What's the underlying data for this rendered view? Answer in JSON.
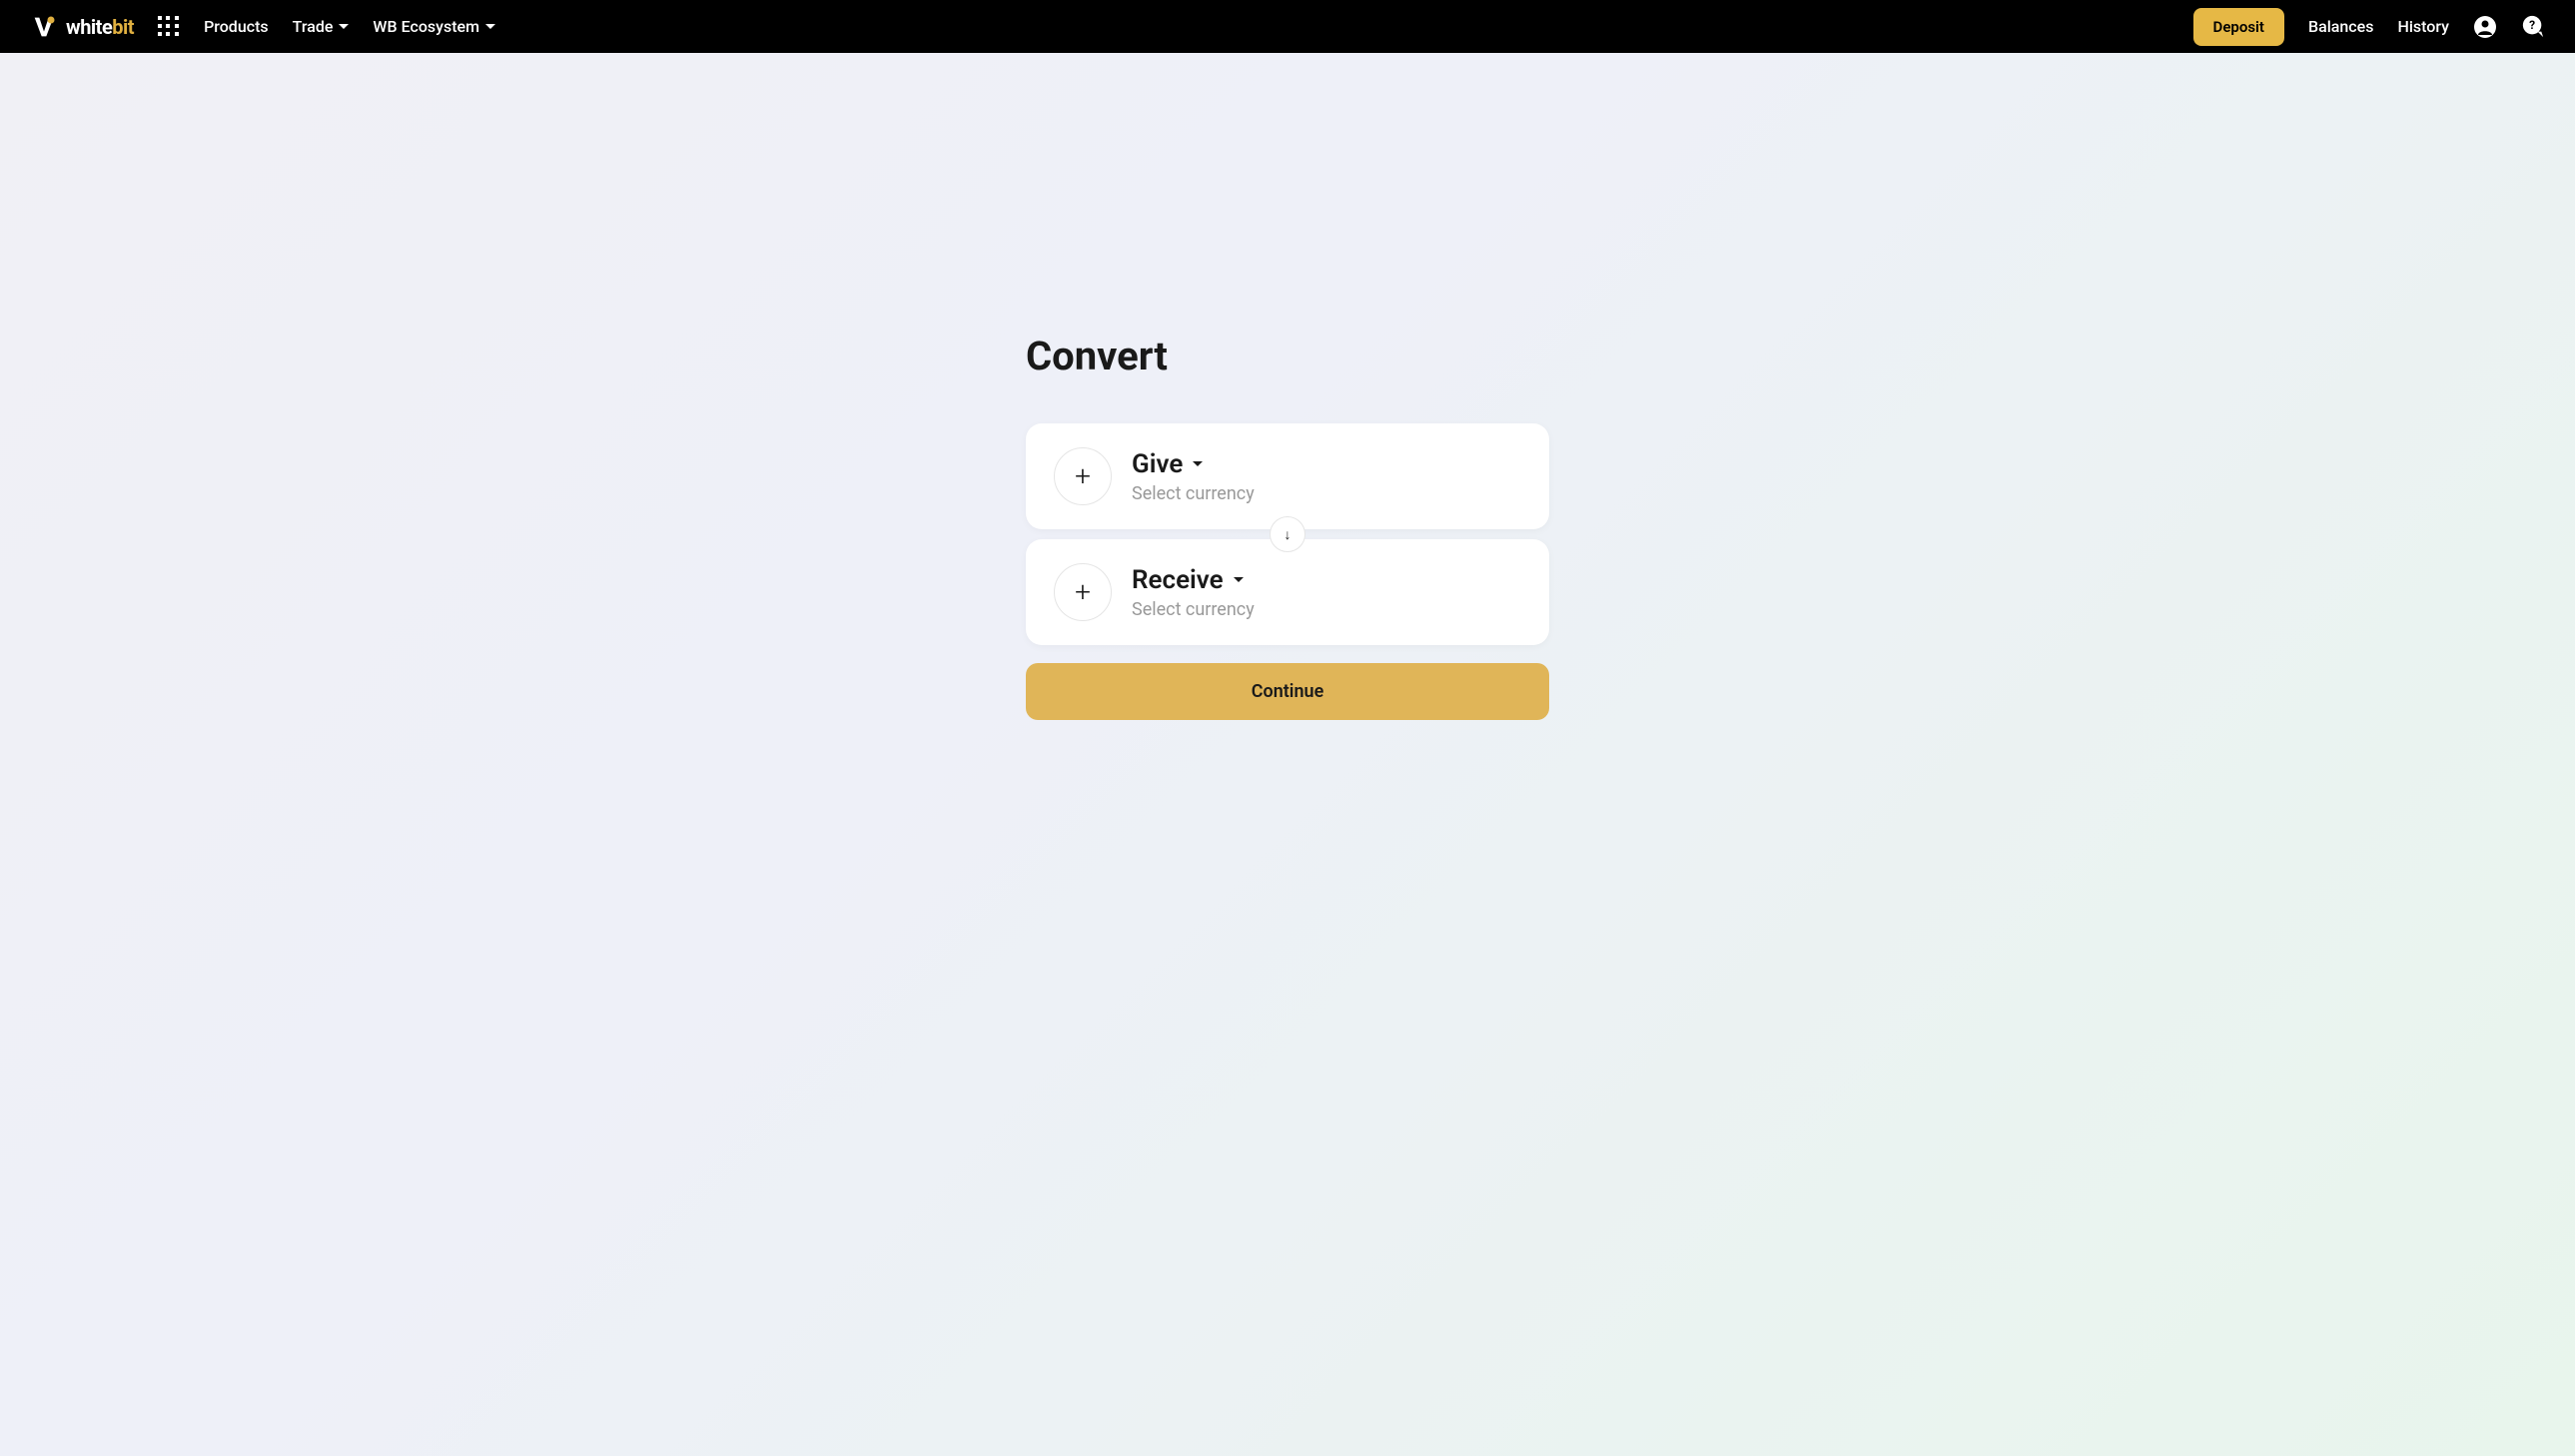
{
  "header": {
    "logo": {
      "text_white": "white",
      "text_bit": "bit"
    },
    "nav": {
      "products": "Products",
      "trade": "Trade",
      "ecosystem": "WB Ecosystem"
    },
    "deposit_btn": "Deposit",
    "balances": "Balances",
    "history": "History"
  },
  "convert": {
    "title": "Convert",
    "give": {
      "label": "Give",
      "hint": "Select currency"
    },
    "receive": {
      "label": "Receive",
      "hint": "Select currency"
    },
    "continue_btn": "Continue"
  }
}
